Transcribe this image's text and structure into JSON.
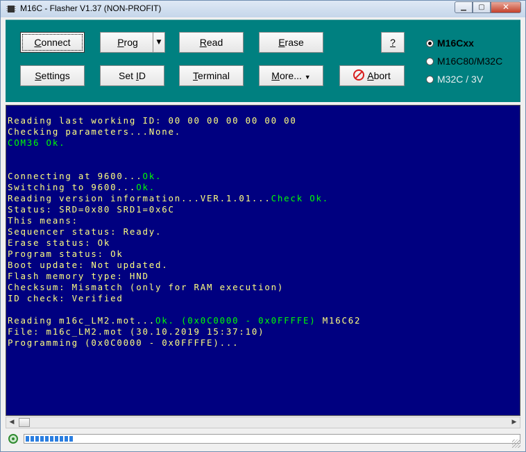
{
  "window": {
    "title": "M16C - Flasher  V1.37 (NON-PROFIT)"
  },
  "toolbar": {
    "row1": [
      {
        "key": "connect",
        "pre": "",
        "mn": "C",
        "post": "onnect"
      },
      {
        "key": "prog",
        "pre": "",
        "mn": "P",
        "post": "rog"
      },
      {
        "key": "read",
        "pre": "",
        "mn": "R",
        "post": "ead"
      },
      {
        "key": "erase",
        "pre": "",
        "mn": "E",
        "post": "rase"
      },
      {
        "key": "help",
        "pre": "",
        "mn": "?",
        "post": ""
      }
    ],
    "row2": [
      {
        "key": "settings",
        "pre": "",
        "mn": "S",
        "post": "ettings"
      },
      {
        "key": "setid",
        "pre": "Set ",
        "mn": "I",
        "post": "D"
      },
      {
        "key": "terminal",
        "pre": "",
        "mn": "T",
        "post": "erminal"
      },
      {
        "key": "more",
        "pre": "",
        "mn": "M",
        "post": "ore..."
      },
      {
        "key": "abort",
        "pre": "",
        "mn": "A",
        "post": "bort"
      }
    ],
    "prog_dropdown_arrow": "▼",
    "more_arrow": "▼",
    "radios": [
      {
        "pre": "M16C",
        "mn": "x",
        "post": "x",
        "selected": true
      },
      {
        "pre": "M16C",
        "mn": "8",
        "post": "0/M32C",
        "selected": false
      },
      {
        "pre": "M32C / ",
        "mn": "3",
        "post": "V",
        "selected": false
      }
    ]
  },
  "console": {
    "lines": [
      [
        {
          "t": "Reading last working ID: 00 00 00 00 00 00 00"
        }
      ],
      [
        {
          "t": "Checking parameters...None."
        }
      ],
      [
        {
          "t": "COM36 Ok.",
          "ok": true
        }
      ],
      [
        {
          "t": ""
        }
      ],
      [
        {
          "t": ""
        }
      ],
      [
        {
          "t": "Connecting at 9600..."
        },
        {
          "t": "Ok.",
          "ok": true
        }
      ],
      [
        {
          "t": "Switching to 9600..."
        },
        {
          "t": "Ok.",
          "ok": true
        }
      ],
      [
        {
          "t": "Reading version information...VER.1.01..."
        },
        {
          "t": "Check Ok.",
          "ok": true
        }
      ],
      [
        {
          "t": "Status: SRD=0x80 SRD1=0x6C"
        }
      ],
      [
        {
          "t": "This means:"
        }
      ],
      [
        {
          "t": "Sequencer status: Ready."
        }
      ],
      [
        {
          "t": "Erase status: Ok"
        }
      ],
      [
        {
          "t": "Program status: Ok"
        }
      ],
      [
        {
          "t": "Boot update: Not updated."
        }
      ],
      [
        {
          "t": "Flash memory type: HND"
        }
      ],
      [
        {
          "t": "Checksum: Mismatch (only for RAM execution)"
        }
      ],
      [
        {
          "t": "ID check: Verified"
        }
      ],
      [
        {
          "t": ""
        }
      ],
      [
        {
          "t": "Reading m16c_LM2.mot..."
        },
        {
          "t": "Ok. (0x0C0000 - 0x0FFFFE)",
          "ok": true
        },
        {
          "t": " M16C62"
        }
      ],
      [
        {
          "t": "File: m16c_LM2.mot (30.10.2019 15:37:10)"
        }
      ],
      [
        {
          "t": "Programming (0x0C0000 - 0x0FFFFE)..."
        }
      ]
    ]
  },
  "scrollbar": {
    "left_arrow": "◀",
    "right_arrow": "▶"
  },
  "progress": {
    "segments": 10
  },
  "colors": {
    "toolbar": "#008080",
    "console_bg": "#000080",
    "text": "#ffff80",
    "ok": "#00ff00"
  }
}
